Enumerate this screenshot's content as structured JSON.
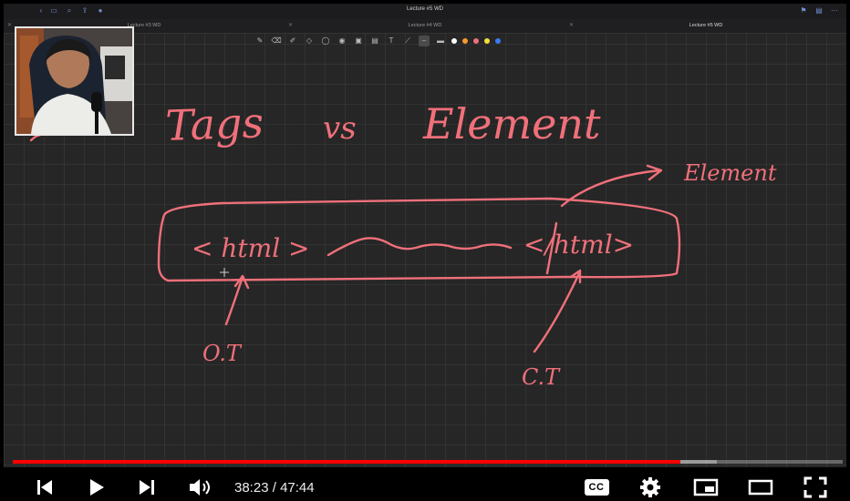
{
  "app": {
    "doc_title": "Lecture #5 WD",
    "tabs": [
      {
        "label": "Lecture #3 WD"
      },
      {
        "label": "Lecture #4 WD"
      },
      {
        "label": "Lecture #5 WD"
      }
    ]
  },
  "whiteboard": {
    "title_left": "Tags",
    "title_mid": "vs",
    "title_right": "Element",
    "snippet_open": "< html >",
    "snippet_close": "</html>",
    "label_element": "Element",
    "label_opening": "O.T",
    "label_closing": "C.T"
  },
  "player": {
    "current_time": "38:23",
    "duration": "47:44",
    "played_fraction": 0.804,
    "loaded_fraction": 0.848,
    "cc_label": "CC"
  },
  "colors": {
    "ink": "#f0707a",
    "progress": "#ff0000"
  }
}
